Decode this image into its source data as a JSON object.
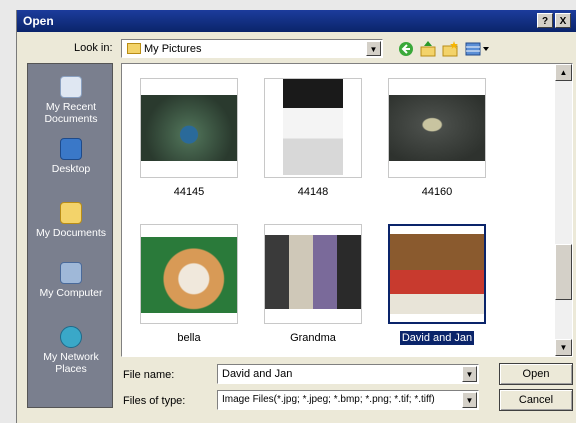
{
  "window": {
    "title": "Open",
    "help_label": "?",
    "close_label": "X"
  },
  "lookin": {
    "label": "Look in:",
    "value": "My Pictures"
  },
  "toolbar": {
    "icons": [
      "back-icon",
      "up-folder-icon",
      "new-folder-icon",
      "views-menu-icon"
    ]
  },
  "places": [
    {
      "label": "My Recent Documents",
      "icon": "recent-documents-icon"
    },
    {
      "label": "Desktop",
      "icon": "desktop-icon"
    },
    {
      "label": "My Documents",
      "icon": "my-documents-icon"
    },
    {
      "label": "My Computer",
      "icon": "my-computer-icon"
    },
    {
      "label": "My Network Places",
      "icon": "network-places-icon"
    }
  ],
  "files": [
    {
      "name": "44145",
      "selected": false
    },
    {
      "name": "44148",
      "selected": false
    },
    {
      "name": "44160",
      "selected": false
    },
    {
      "name": "bella",
      "selected": false
    },
    {
      "name": "Grandma",
      "selected": false
    },
    {
      "name": "David and Jan",
      "selected": true
    }
  ],
  "filename": {
    "label": "File name:",
    "value": "David and Jan"
  },
  "filetype": {
    "label": "Files of type:",
    "value": "Image Files(*.jpg; *.jpeg; *.bmp; *.png; *.tif; *.tiff)"
  },
  "buttons": {
    "open": "Open",
    "cancel": "Cancel"
  }
}
